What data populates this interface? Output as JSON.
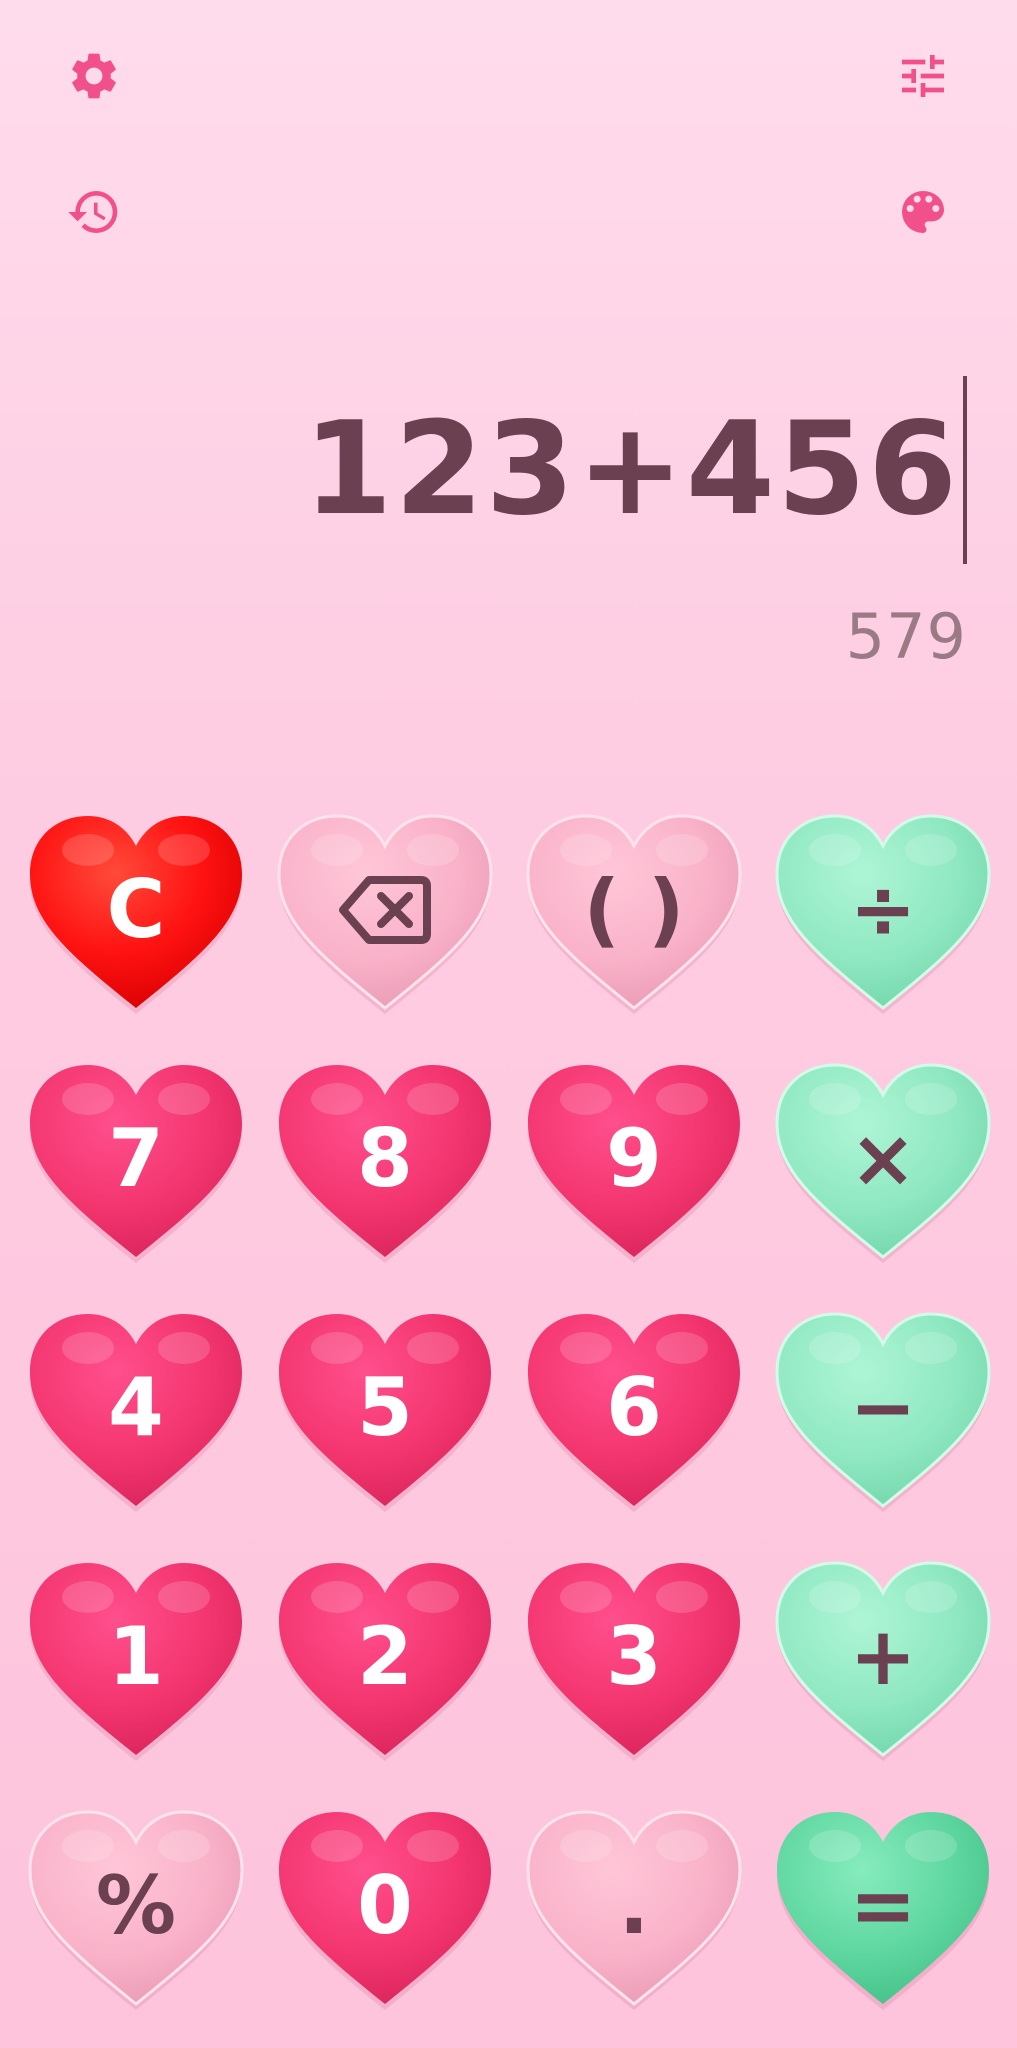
{
  "toolbar": {
    "settings_icon": "settings-gear-icon",
    "tune_icon": "tune-sliders-icon",
    "history_icon": "history-icon",
    "palette_icon": "palette-icon"
  },
  "display": {
    "expression": "123+456",
    "result": "579"
  },
  "colors": {
    "icon_accent": "#f2508a",
    "red_heart": "#ff1a1a",
    "pink_heart": "#f23a78",
    "light_pink_heart": "#f9b2c9",
    "mint_heart": "#8fe8c2",
    "equals_heart": "#5ed6a0",
    "dark_text": "#6b4050"
  },
  "keys": [
    {
      "id": "clear",
      "label": "C",
      "style": "red"
    },
    {
      "id": "backspace",
      "label": "",
      "icon": "backspace-icon",
      "style": "lightpink"
    },
    {
      "id": "parentheses",
      "label": "( )",
      "style": "lightpink"
    },
    {
      "id": "divide",
      "label": "÷",
      "style": "mint"
    },
    {
      "id": "7",
      "label": "7",
      "style": "pink"
    },
    {
      "id": "8",
      "label": "8",
      "style": "pink"
    },
    {
      "id": "9",
      "label": "9",
      "style": "pink"
    },
    {
      "id": "multiply",
      "label": "×",
      "style": "mint"
    },
    {
      "id": "4",
      "label": "4",
      "style": "pink"
    },
    {
      "id": "5",
      "label": "5",
      "style": "pink"
    },
    {
      "id": "6",
      "label": "6",
      "style": "pink"
    },
    {
      "id": "minus",
      "label": "−",
      "style": "mint"
    },
    {
      "id": "1",
      "label": "1",
      "style": "pink"
    },
    {
      "id": "2",
      "label": "2",
      "style": "pink"
    },
    {
      "id": "3",
      "label": "3",
      "style": "pink"
    },
    {
      "id": "plus",
      "label": "+",
      "style": "mint"
    },
    {
      "id": "percent",
      "label": "%",
      "style": "lightpink"
    },
    {
      "id": "0",
      "label": "0",
      "style": "pink"
    },
    {
      "id": "decimal",
      "label": ".",
      "style": "lightpink"
    },
    {
      "id": "equals",
      "label": "=",
      "style": "green"
    }
  ]
}
